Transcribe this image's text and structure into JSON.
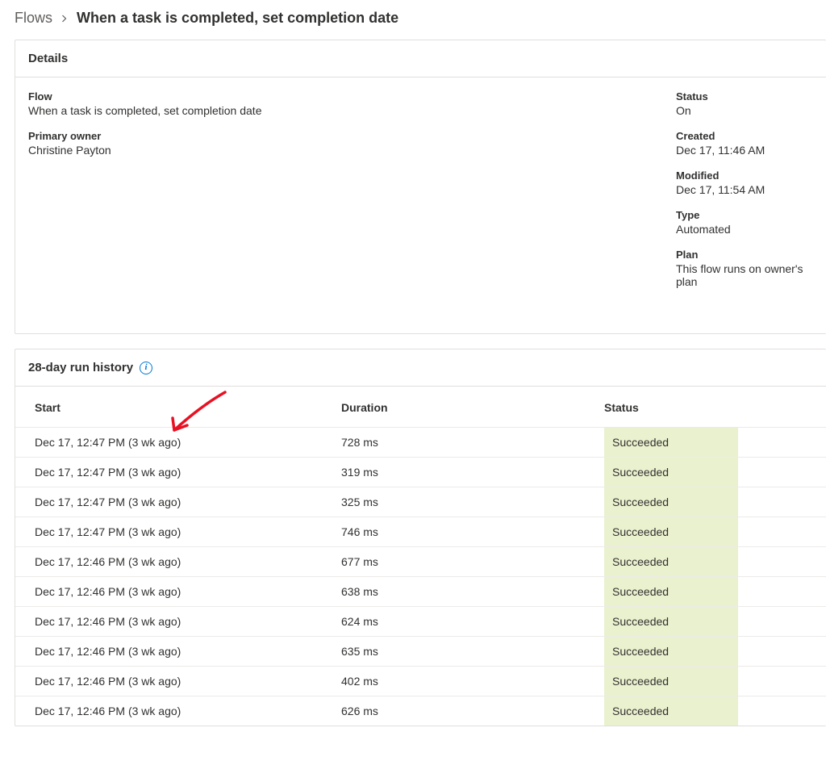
{
  "breadcrumb": {
    "parent": "Flows",
    "current": "When a task is completed, set completion date"
  },
  "details": {
    "header": "Details",
    "flow": {
      "label": "Flow",
      "value": "When a task is completed, set completion date"
    },
    "primary_owner": {
      "label": "Primary owner",
      "value": "Christine Payton"
    },
    "status": {
      "label": "Status",
      "value": "On"
    },
    "created": {
      "label": "Created",
      "value": "Dec 17, 11:46 AM"
    },
    "modified": {
      "label": "Modified",
      "value": "Dec 17, 11:54 AM"
    },
    "type": {
      "label": "Type",
      "value": "Automated"
    },
    "plan": {
      "label": "Plan",
      "value": "This flow runs on owner's plan"
    }
  },
  "run_history": {
    "header": "28-day run history",
    "columns": {
      "start": "Start",
      "duration": "Duration",
      "status": "Status"
    },
    "rows": [
      {
        "start": "Dec 17, 12:47 PM (3 wk ago)",
        "duration": "728 ms",
        "status": "Succeeded"
      },
      {
        "start": "Dec 17, 12:47 PM (3 wk ago)",
        "duration": "319 ms",
        "status": "Succeeded"
      },
      {
        "start": "Dec 17, 12:47 PM (3 wk ago)",
        "duration": "325 ms",
        "status": "Succeeded"
      },
      {
        "start": "Dec 17, 12:47 PM (3 wk ago)",
        "duration": "746 ms",
        "status": "Succeeded"
      },
      {
        "start": "Dec 17, 12:46 PM (3 wk ago)",
        "duration": "677 ms",
        "status": "Succeeded"
      },
      {
        "start": "Dec 17, 12:46 PM (3 wk ago)",
        "duration": "638 ms",
        "status": "Succeeded"
      },
      {
        "start": "Dec 17, 12:46 PM (3 wk ago)",
        "duration": "624 ms",
        "status": "Succeeded"
      },
      {
        "start": "Dec 17, 12:46 PM (3 wk ago)",
        "duration": "635 ms",
        "status": "Succeeded"
      },
      {
        "start": "Dec 17, 12:46 PM (3 wk ago)",
        "duration": "402 ms",
        "status": "Succeeded"
      },
      {
        "start": "Dec 17, 12:46 PM (3 wk ago)",
        "duration": "626 ms",
        "status": "Succeeded"
      }
    ]
  }
}
